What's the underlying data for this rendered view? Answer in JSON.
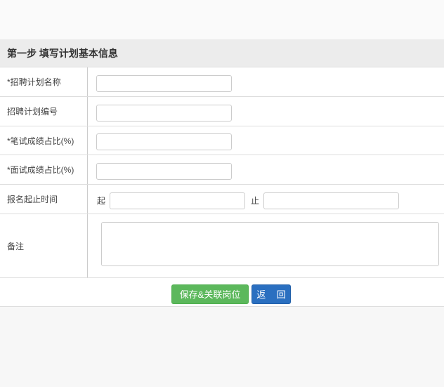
{
  "header": {
    "title": "第一步  填写计划基本信息"
  },
  "fields": [
    {
      "label": "*招聘计划名称",
      "value": ""
    },
    {
      "label": "招聘计划编号",
      "value": ""
    },
    {
      "label": "*笔试成绩占比(%)",
      "value": ""
    },
    {
      "label": "*面试成绩占比(%)",
      "value": ""
    }
  ],
  "date_range": {
    "label": "报名起止时间",
    "start_label": "起",
    "end_label": "止",
    "start_value": "",
    "end_value": ""
  },
  "remark": {
    "label": "备注",
    "value": ""
  },
  "buttons": {
    "save": "保存&关联岗位",
    "back": "返 回"
  }
}
